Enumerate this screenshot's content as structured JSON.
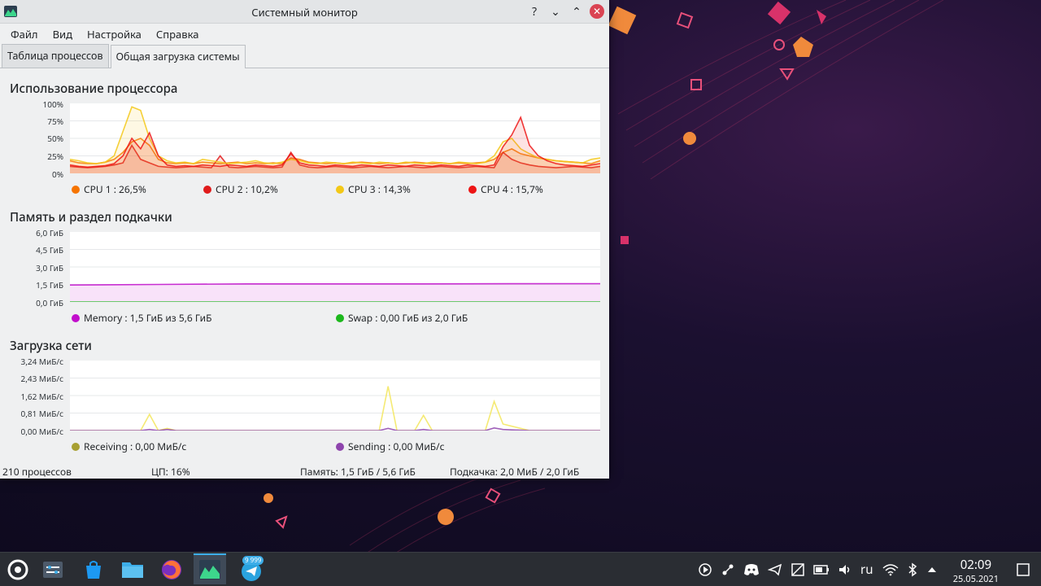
{
  "window": {
    "title": "Системный монитор",
    "help": "?",
    "minimize": "⌄",
    "maximize": "⌃",
    "close": "✕"
  },
  "menu": [
    "Файл",
    "Вид",
    "Настройка",
    "Справка"
  ],
  "tabs": [
    {
      "label": "Таблица процессов",
      "active": false
    },
    {
      "label": "Общая загрузка системы",
      "active": true
    }
  ],
  "cpu": {
    "title": "Использование процессора",
    "yticks": [
      "100%",
      "75%",
      "50%",
      "25%",
      "0%"
    ],
    "legend": [
      {
        "label": "CPU 1 : 26,5%",
        "color": "#f67400"
      },
      {
        "label": "CPU 2 : 10,2%",
        "color": "#e01b1b"
      },
      {
        "label": "CPU 3 : 14,3%",
        "color": "#f3c817"
      },
      {
        "label": "CPU 4 : 15,7%",
        "color": "#ed1515"
      }
    ]
  },
  "memory": {
    "title": "Память и раздел подкачки",
    "yticks": [
      "6,0 ГиБ",
      "4,5 ГиБ",
      "3,0 ГиБ",
      "1,5 ГиБ",
      "0,0 ГиБ"
    ],
    "legend": [
      {
        "label": "Memory : 1,5 ГиБ из 5,6 ГиБ",
        "color": "#c20fcc"
      },
      {
        "label": "Swap : 0,00 ГиБ из 2,0 ГиБ",
        "color": "#1cb81c"
      }
    ]
  },
  "network": {
    "title": "Загрузка сети",
    "yticks": [
      "3,24 МиБ/с",
      "2,43 МиБ/с",
      "1,62 МиБ/с",
      "0,81 МиБ/с",
      "0,00 МиБ/с"
    ],
    "legend": [
      {
        "label": "Receiving : 0,00 МиБ/с",
        "color": "#a8a032"
      },
      {
        "label": "Sending : 0,00 МиБ/с",
        "color": "#8e44ad"
      }
    ]
  },
  "status": {
    "processes": "210 процессов",
    "cpu": "ЦП: 16%",
    "memory": "Память: 1,5 ГиБ / 5,6 ГиБ",
    "swap": "Подкачка: 2,0 МиБ / 2,0 ГиБ"
  },
  "taskbar": {
    "telegram_badge": "9 999",
    "keyboard_layout": "ru",
    "time": "02:09",
    "date": "25.05.2021"
  },
  "chart_data": [
    {
      "type": "area",
      "title": "Использование процессора",
      "ylim": [
        0,
        100
      ],
      "x": [
        0,
        1,
        2,
        3,
        4,
        5,
        6,
        7,
        8,
        9,
        10,
        11,
        12,
        13,
        14,
        15,
        16,
        17,
        18,
        19,
        20,
        21,
        22,
        23,
        24,
        25,
        26,
        27,
        28,
        29,
        30,
        31,
        32,
        33,
        34,
        35,
        36,
        37,
        38,
        39,
        40,
        41,
        42,
        43,
        44,
        45,
        46,
        47,
        48,
        49,
        50,
        51,
        52,
        53,
        54,
        55,
        56,
        57,
        58,
        59,
        60
      ],
      "series": [
        {
          "name": "CPU 1",
          "color": "#f67400",
          "values": [
            18,
            15,
            14,
            14,
            16,
            20,
            30,
            45,
            50,
            40,
            20,
            15,
            14,
            15,
            14,
            16,
            15,
            14,
            15,
            16,
            14,
            15,
            14,
            15,
            14,
            22,
            20,
            16,
            15,
            14,
            15,
            14,
            15,
            16,
            15,
            14,
            15,
            14,
            15,
            16,
            15,
            14,
            15,
            14,
            15,
            14,
            15,
            16,
            20,
            30,
            35,
            28,
            25,
            22,
            20,
            18,
            17,
            16,
            15,
            14,
            18
          ]
        },
        {
          "name": "CPU 2",
          "color": "#e01b1b",
          "values": [
            10,
            9,
            8,
            9,
            10,
            12,
            15,
            40,
            20,
            15,
            10,
            9,
            8,
            9,
            10,
            9,
            8,
            25,
            9,
            8,
            9,
            10,
            9,
            8,
            9,
            30,
            12,
            9,
            8,
            9,
            10,
            9,
            8,
            9,
            10,
            9,
            8,
            9,
            10,
            9,
            8,
            9,
            10,
            9,
            8,
            9,
            10,
            9,
            8,
            30,
            20,
            15,
            12,
            10,
            9,
            8,
            9,
            10,
            9,
            8,
            10
          ]
        },
        {
          "name": "CPU 3",
          "color": "#f3c817",
          "values": [
            20,
            18,
            15,
            14,
            16,
            25,
            60,
            95,
            90,
            50,
            25,
            18,
            15,
            16,
            14,
            20,
            18,
            16,
            14,
            15,
            16,
            18,
            15,
            14,
            16,
            20,
            18,
            15,
            14,
            16,
            15,
            14,
            16,
            15,
            14,
            16,
            15,
            14,
            16,
            15,
            14,
            16,
            15,
            14,
            16,
            15,
            14,
            16,
            25,
            45,
            50,
            35,
            28,
            22,
            20,
            18,
            17,
            16,
            15,
            20,
            22
          ]
        },
        {
          "name": "CPU 4",
          "color": "#ed1515",
          "values": [
            12,
            10,
            9,
            10,
            11,
            14,
            25,
            50,
            35,
            58,
            25,
            12,
            10,
            11,
            10,
            12,
            11,
            10,
            12,
            11,
            10,
            12,
            11,
            10,
            12,
            28,
            15,
            12,
            11,
            10,
            12,
            11,
            10,
            12,
            11,
            10,
            12,
            11,
            10,
            12,
            11,
            10,
            12,
            11,
            10,
            12,
            11,
            10,
            12,
            38,
            55,
            80,
            40,
            25,
            18,
            14,
            12,
            11,
            10,
            12,
            14
          ]
        }
      ]
    },
    {
      "type": "area",
      "title": "Память и раздел подкачки",
      "ylim": [
        0,
        6.0
      ],
      "x": [
        0,
        10,
        20,
        30,
        40,
        50,
        60
      ],
      "series": [
        {
          "name": "Memory",
          "color": "#c20fcc",
          "values": [
            1.45,
            1.5,
            1.55,
            1.55,
            1.55,
            1.56,
            1.57
          ]
        },
        {
          "name": "Swap",
          "color": "#1cb81c",
          "values": [
            0.0,
            0.0,
            0.0,
            0.0,
            0.0,
            0.0,
            0.0
          ]
        }
      ]
    },
    {
      "type": "line",
      "title": "Загрузка сети",
      "ylim": [
        0,
        3.24
      ],
      "x": [
        0,
        1,
        2,
        3,
        4,
        5,
        6,
        7,
        8,
        9,
        10,
        11,
        12,
        13,
        14,
        15,
        16,
        17,
        18,
        19,
        20,
        21,
        22,
        23,
        24,
        25,
        26,
        27,
        28,
        29,
        30,
        31,
        32,
        33,
        34,
        35,
        36,
        37,
        38,
        39,
        40,
        41,
        42,
        43,
        44,
        45,
        46,
        47,
        48,
        49,
        50,
        51,
        52,
        53,
        54,
        55,
        56,
        57,
        58,
        59,
        60
      ],
      "series": [
        {
          "name": "Receiving",
          "color": "#f3e65c",
          "values": [
            0,
            0,
            0,
            0,
            0,
            0,
            0,
            0,
            0,
            0.75,
            0,
            0.1,
            0,
            0,
            0,
            0,
            0,
            0,
            0,
            0,
            0,
            0,
            0,
            0,
            0,
            0,
            0,
            0,
            0,
            0,
            0,
            0,
            0,
            0,
            0,
            0,
            2.05,
            0,
            0,
            0,
            0.7,
            0,
            0,
            0,
            0,
            0,
            0,
            0,
            1.35,
            0.3,
            0.2,
            0.1,
            0,
            0,
            0,
            0,
            0,
            0,
            0,
            0,
            0
          ]
        },
        {
          "name": "Sending",
          "color": "#8e44ad",
          "values": [
            0,
            0,
            0,
            0,
            0,
            0,
            0,
            0,
            0,
            0.05,
            0,
            0.05,
            0,
            0,
            0,
            0,
            0,
            0,
            0,
            0,
            0,
            0,
            0,
            0,
            0,
            0,
            0,
            0,
            0,
            0,
            0,
            0,
            0,
            0,
            0,
            0,
            0.1,
            0,
            0,
            0,
            0.05,
            0,
            0,
            0,
            0,
            0,
            0,
            0,
            0.12,
            0.05,
            0.03,
            0.02,
            0,
            0,
            0,
            0,
            0,
            0,
            0,
            0,
            0
          ]
        }
      ]
    }
  ]
}
